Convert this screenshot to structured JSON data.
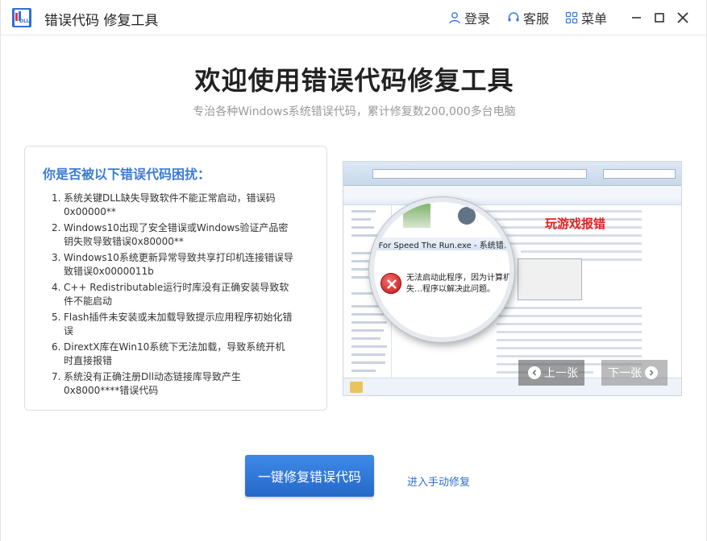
{
  "window": {
    "title": "错误代码 修复工具",
    "logo_text": "DLL"
  },
  "titlebar": {
    "login_label": "登录",
    "service_label": "客服",
    "menu_label": "菜单"
  },
  "main": {
    "title": "欢迎使用错误代码修复工具",
    "subtitle": "专治各种Windows系统错误代码，累计修复数200,000多台电脑"
  },
  "problems": {
    "heading": "你是否被以下错误代码困扰：",
    "items": [
      {
        "num": "1.",
        "text": "系统关键DLL缺失导致软件不能正常启动，错误码0x00000**"
      },
      {
        "num": "2.",
        "text": "Windows10出现了安全错误或Windows验证产品密钥失败导致错误0x80000**"
      },
      {
        "num": "3.",
        "text": "Windows10系统更新异常导致共享打印机连接错误导致错误0x0000011b"
      },
      {
        "num": "4.",
        "text": "C++ Redistributable运行时库没有正确安装导致软件不能启动"
      },
      {
        "num": "5.",
        "text": "Flash插件未安装或未加载导致提示应用程序初始化错误"
      },
      {
        "num": "6.",
        "text": "DirextX库在Win10系统下无法加载，导致系统开机时直接报错"
      },
      {
        "num": "7.",
        "text": "系统没有正确注册Dll动态链接库导致产生0x8000****错误代码"
      }
    ]
  },
  "carousel": {
    "window_title_zoom": "d For Speed The Run.exe - 系统错误",
    "error_message": "无法启动此程序，因为计算机中丢失…程序以解决此问题。",
    "caption": "玩游戏报错",
    "prev_label": "上一张",
    "next_label": "下一张"
  },
  "actions": {
    "fix_button_label": "一键修复错误代码",
    "manual_link_label": "进入手动修复"
  },
  "colors": {
    "accent": "#3a7bd5",
    "primary_button": "#2f78da",
    "error_red": "#e02020"
  }
}
